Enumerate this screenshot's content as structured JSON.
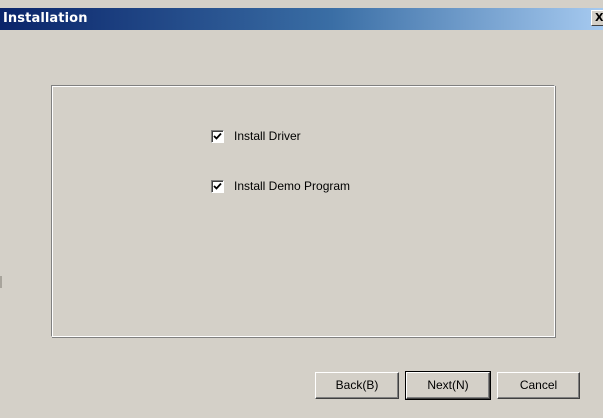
{
  "window": {
    "title": "Installation",
    "close_glyph": "X"
  },
  "options": [
    {
      "label": "Install Driver",
      "checked": true
    },
    {
      "label": "Install Demo Program",
      "checked": true
    }
  ],
  "buttons": {
    "back": "Back(B)",
    "next": "Next(N)",
    "cancel": "Cancel"
  },
  "colors": {
    "title_bar_start": "#0a246a",
    "title_bar_end": "#a6caf0",
    "face": "#d4d0c8"
  },
  "icons": {
    "close": "close-icon",
    "check": "checkmark-icon"
  }
}
